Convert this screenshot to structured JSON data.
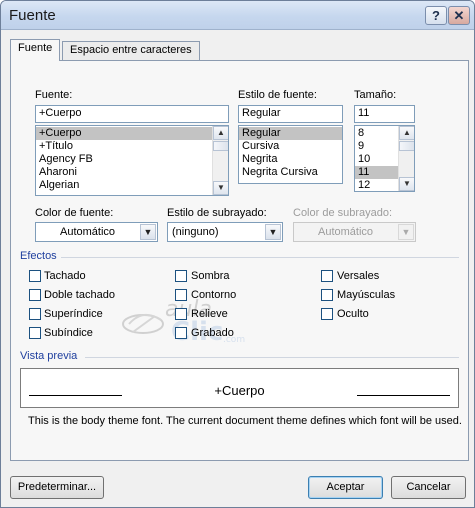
{
  "window": {
    "title": "Fuente",
    "help_button": "?",
    "close_button": "✕"
  },
  "tabs": [
    {
      "label": "Fuente",
      "active": true
    },
    {
      "label": "Espacio entre caracteres",
      "active": false
    }
  ],
  "font": {
    "label": "Fuente:",
    "value": "+Cuerpo",
    "items": [
      "+Cuerpo",
      "+Título",
      "Agency FB",
      "Aharoni",
      "Algerian"
    ],
    "selected_index": 0
  },
  "style": {
    "label": "Estilo de fuente:",
    "value": "Regular",
    "items": [
      "Regular",
      "Cursiva",
      "Negrita",
      "Negrita Cursiva"
    ],
    "selected_index": 0
  },
  "size": {
    "label": "Tamaño:",
    "value": "11",
    "items": [
      "8",
      "9",
      "10",
      "11",
      "12"
    ],
    "selected_index": 3
  },
  "font_color": {
    "label": "Color de fuente:",
    "value": "Automático"
  },
  "underline_style": {
    "label": "Estilo de subrayado:",
    "value": "(ninguno)"
  },
  "underline_color": {
    "label": "Color de subrayado:",
    "value": "Automático",
    "disabled": true
  },
  "effects": {
    "title": "Efectos",
    "items": [
      {
        "label": "Tachado",
        "checked": false
      },
      {
        "label": "Doble tachado",
        "checked": false
      },
      {
        "label": "Superíndice",
        "checked": false
      },
      {
        "label": "Subíndice",
        "checked": false
      },
      {
        "label": "Sombra",
        "checked": false
      },
      {
        "label": "Contorno",
        "checked": false
      },
      {
        "label": "Relieve",
        "checked": false
      },
      {
        "label": "Grabado",
        "checked": false
      },
      {
        "label": "Versales",
        "checked": false
      },
      {
        "label": "Mayúsculas",
        "checked": false
      },
      {
        "label": "Oculto",
        "checked": false
      }
    ]
  },
  "watermark": {
    "line1": "aula",
    "line2": "Clic",
    "suffix": ".com"
  },
  "preview": {
    "title": "Vista previa",
    "sample": "+Cuerpo",
    "description": "This is the body theme font. The current document theme defines which font will be used."
  },
  "buttons": {
    "default": "Predeterminar...",
    "ok": "Aceptar",
    "cancel": "Cancelar"
  },
  "colors": {
    "accent_blue": "#1f3f9e",
    "selection_gray": "#c3c3c3"
  }
}
